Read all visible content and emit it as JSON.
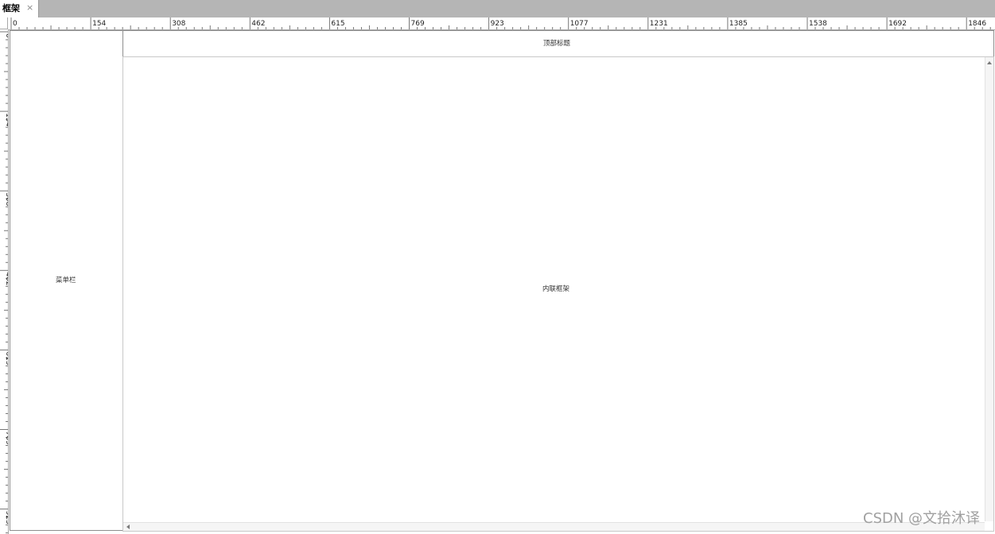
{
  "tab": {
    "label": "框架",
    "close": "×"
  },
  "ruler": {
    "horizontal_labels": [
      "0",
      "154",
      "308",
      "462",
      "615",
      "769",
      "923",
      "1077",
      "1231",
      "1385",
      "1538",
      "1692",
      "1846"
    ],
    "vertical_labels": [
      "0",
      "154",
      "308",
      "462",
      "615",
      "769",
      "923"
    ]
  },
  "frames": {
    "menu_label": "菜单栏",
    "top_label": "顶部标题",
    "inline_label": "内联框架"
  },
  "watermark": "CSDN @文拾沐译"
}
